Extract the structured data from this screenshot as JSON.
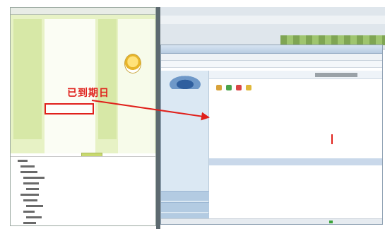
{
  "annotation": {
    "text": "已到期日",
    "color": "#e0201b"
  },
  "colors": {
    "left_bg": "#e7f2c5",
    "left_accent": "#d7e8a7",
    "browser_sidebar": "#dbe8f3",
    "arrow": "#e0201b"
  },
  "icons": {
    "avatar": "lightbulb-face-icon",
    "logo": "brand-logo-icon"
  }
}
